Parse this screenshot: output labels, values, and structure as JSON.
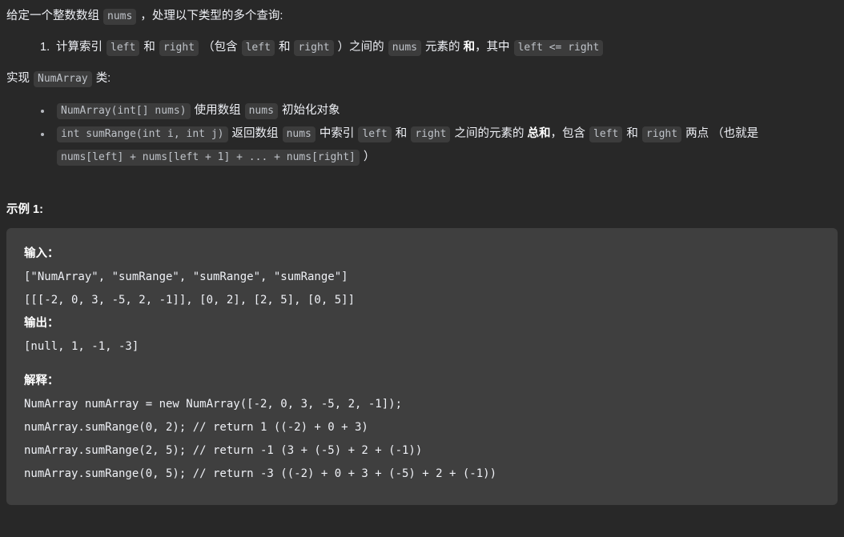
{
  "theme": {
    "page_bg": "#282828",
    "code_block_bg": "#3f3f3f",
    "inline_code_bg": "#3c3c3c",
    "inline_code_fg": "#bfc3c9",
    "text_fg": "#eff1f6"
  },
  "intro": {
    "before_code": "给定一个整数数组",
    "code_nums": "nums",
    "after_code": "，处理以下类型的多个查询:"
  },
  "query_list": [
    {
      "t1": "计算索引",
      "c1": "left",
      "t2": "和",
      "c2": "right",
      "t3": "（包含",
      "c3": "left",
      "t4": "和",
      "c4": "right",
      "t5": "）之间的",
      "c5": "nums",
      "t6": "元素的",
      "bold": "和",
      "t7": "，其中",
      "c6": "left <= right"
    }
  ],
  "implement": {
    "before": "实现",
    "code": "NumArray",
    "after": "类:"
  },
  "methods": [
    {
      "code": "NumArray(int[] nums)",
      "t1": "使用数组",
      "c1": "nums",
      "t2": "初始化对象"
    },
    {
      "code": "int sumRange(int i, int j)",
      "t1": "返回数组",
      "c1": "nums",
      "t2": "中索引",
      "c2": "left",
      "t3": "和",
      "c3": "right",
      "t4": "之间的元素的",
      "bold": "总和",
      "t5": "，包含",
      "c4": "left",
      "t6": "和",
      "c5": "right",
      "t7": "两点",
      "wrap_t1": "（也就是",
      "wrap_c1": "nums[left] + nums[left + 1] + ... + nums[right]",
      "wrap_t2": "）"
    }
  ],
  "example": {
    "title": "示例 1:",
    "input_label": "输入：",
    "input_lines": [
      "[\"NumArray\", \"sumRange\", \"sumRange\", \"sumRange\"]",
      "[[[-2, 0, 3, -5, 2, -1]], [0, 2], [2, 5], [0, 5]]"
    ],
    "output_label": "输出：",
    "output_lines": [
      "[null, 1, -1, -3]"
    ],
    "explain_label": "解释：",
    "explain_lines": [
      "NumArray numArray = new NumArray([-2, 0, 3, -5, 2, -1]);",
      "numArray.sumRange(0, 2); // return 1 ((-2) + 0 + 3)",
      "numArray.sumRange(2, 5); // return -1 (3 + (-5) + 2 + (-1))",
      "numArray.sumRange(0, 5); // return -3 ((-2) + 0 + 3 + (-5) + 2 + (-1))"
    ]
  }
}
